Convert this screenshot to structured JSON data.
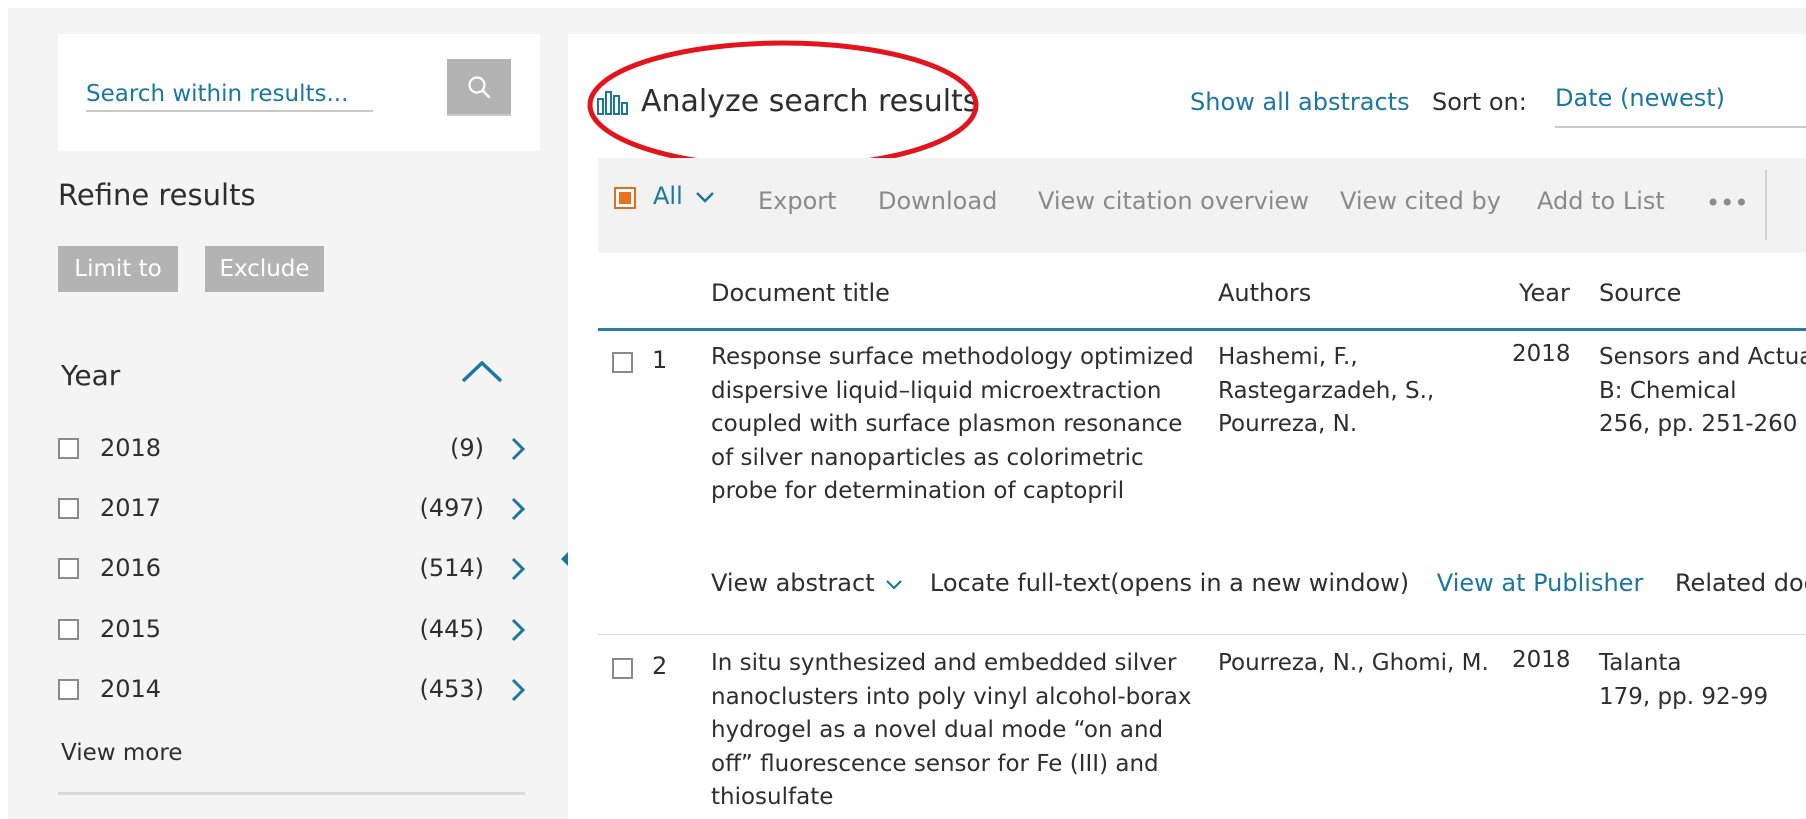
{
  "search": {
    "placeholder": "Search within results..."
  },
  "refine": {
    "title": "Refine results",
    "limit_to": "Limit to",
    "exclude": "Exclude",
    "year_title": "Year",
    "years": [
      {
        "label": "2018",
        "count": "(9)"
      },
      {
        "label": "2017",
        "count": "(497)"
      },
      {
        "label": "2016",
        "count": "(514)"
      },
      {
        "label": "2015",
        "count": "(445)"
      },
      {
        "label": "2014",
        "count": "(453)"
      }
    ],
    "view_more": "View more"
  },
  "header": {
    "analyze": "Analyze search results",
    "show_all_abstracts": "Show all abstracts",
    "sort_label": "Sort on:",
    "sort_value": "Date (newest)"
  },
  "toolbar": {
    "all": "All",
    "export": "Export",
    "download": "Download",
    "view_citation_overview": "View citation overview",
    "view_cited_by": "View cited by",
    "add_to_list": "Add to List",
    "more": "•••"
  },
  "table": {
    "headers": {
      "title": "Document title",
      "authors": "Authors",
      "year": "Year",
      "source": "Source"
    },
    "rows": [
      {
        "num": "1",
        "title": "Response surface methodology optimized dispersive liquid–liquid microextraction coupled with surface plasmon resonance of silver nanoparticles as colorimetric probe for determination of captopril",
        "authors": "Hashemi, F., Rastegarzadeh, S., Pourreza, N.",
        "year": "2018",
        "source_line1": "Sensors and Actua",
        "source_line2": "B: Chemical",
        "source_line3": "256, pp. 251-260",
        "actions": {
          "view_abstract": "View abstract",
          "locate": "Locate full-text(opens in a new window)",
          "view_publisher": "View at Publisher",
          "related": "Related docum"
        }
      },
      {
        "num": "2",
        "title": "In situ synthesized and embedded silver nanoclusters into poly vinyl alcohol-borax hydrogel as a novel dual mode “on and off” fluorescence sensor for Fe (III) and thiosulfate",
        "authors": "Pourreza, N., Ghomi, M.",
        "year": "2018",
        "source_line1": "Talanta",
        "source_line2": "179, pp. 92-99"
      }
    ]
  },
  "colors": {
    "link": "#1a77a0",
    "accent_orange": "#e9711c",
    "highlight_red": "#e3141c",
    "button_gray": "#b3b3b3"
  }
}
